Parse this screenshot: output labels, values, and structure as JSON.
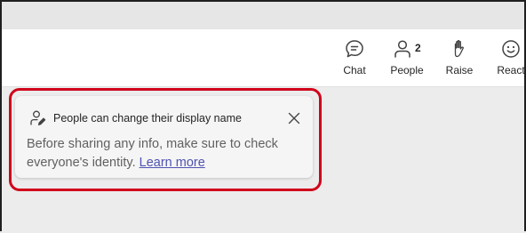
{
  "toolbar": {
    "chat": {
      "label": "Chat",
      "icon": "chat-icon"
    },
    "people": {
      "label": "People",
      "icon": "people-icon",
      "count": "2"
    },
    "raise": {
      "label": "Raise",
      "icon": "hand-icon"
    },
    "react": {
      "label": "React",
      "icon": "smiley-icon"
    }
  },
  "notification": {
    "title": "People can change their display name",
    "body": "Before sharing any info, make sure to check everyone's identity.",
    "link_text": "Learn more",
    "icon": "person-edit-icon",
    "close_icon": "close-icon"
  },
  "colors": {
    "highlight": "#d0021b",
    "link": "#4f52b2",
    "toolbar_bg": "#ffffff",
    "toast_bg": "#f5f5f5"
  }
}
